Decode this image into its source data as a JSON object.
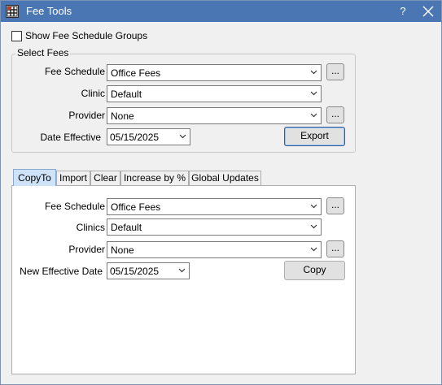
{
  "window": {
    "title": "Fee Tools",
    "help_label": "?",
    "close_icon": "close-icon",
    "app_icon": "grid-icon"
  },
  "show_groups": {
    "label": "Show Fee Schedule Groups",
    "checked": false
  },
  "select_fees": {
    "title": "Select Fees",
    "fee_schedule_label": "Fee Schedule",
    "fee_schedule_value": "Office Fees",
    "clinic_label": "Clinic",
    "clinic_value": "Default",
    "provider_label": "Provider",
    "provider_value": "None",
    "date_label": "Date Effective",
    "date_value": "05/15/2025",
    "ellipsis_label": "...",
    "export_label": "Export"
  },
  "tabs": [
    {
      "label": "CopyTo",
      "active": true
    },
    {
      "label": "Import",
      "active": false
    },
    {
      "label": "Clear",
      "active": false
    },
    {
      "label": "Increase by %",
      "active": false
    },
    {
      "label": "Global Updates",
      "active": false
    }
  ],
  "copy_to": {
    "fee_schedule_label": "Fee Schedule",
    "fee_schedule_value": "Office Fees",
    "clinics_label": "Clinics",
    "clinics_value": "Default",
    "provider_label": "Provider",
    "provider_value": "None",
    "date_label": "New Effective Date",
    "date_value": "05/15/2025",
    "ellipsis_label": "...",
    "copy_label": "Copy"
  }
}
